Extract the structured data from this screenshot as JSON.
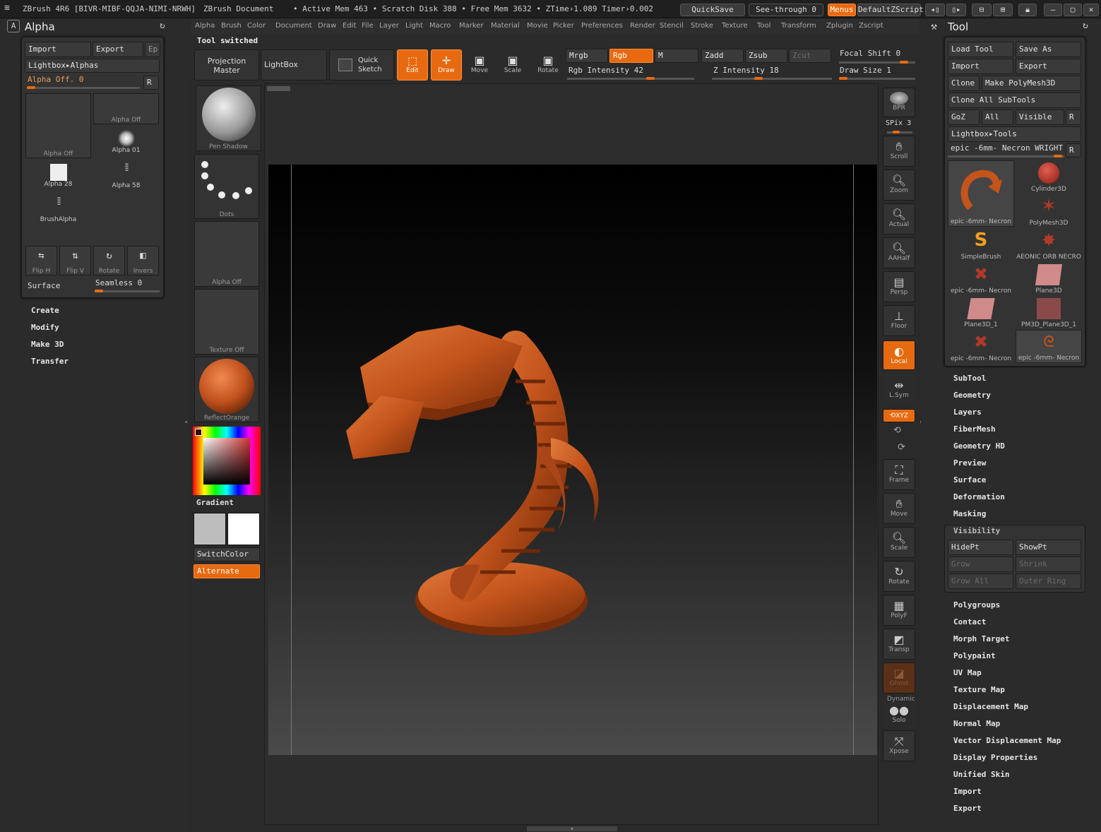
{
  "titlebar": {
    "app": "ZBrush 4R6 [BIVR-MIBF-QQJA-NIMI-NRWH]",
    "doc": "ZBrush Document",
    "mem": "• Active Mem 463 • Scratch Disk 388 • Free Mem 3632 • ZTime›1.089 Timer›0.002",
    "quicksave": "QuickSave",
    "seethrough": "See-through  0",
    "menus": "Menus",
    "script": "DefaultZScript"
  },
  "menus": [
    "Alpha",
    "Brush",
    "Color",
    "Document",
    "Draw",
    "Edit",
    "File",
    "Layer",
    "Light",
    "Macro",
    "Marker",
    "Material",
    "Movie",
    "Picker",
    "Preferences",
    "Render",
    "Stencil",
    "Stroke",
    "Texture",
    "Tool",
    "Transform",
    "Zplugin",
    "Zscript"
  ],
  "status": "Tool switched",
  "alpha": {
    "title": "Alpha",
    "import": "Import",
    "export": "Export",
    "ep": "Ep",
    "lightbox": "Lightbox▸Alphas",
    "slider": "Alpha Off. 0",
    "r": "R",
    "thumbs": [
      "Alpha Off",
      "Alpha Off",
      "Alpha 01",
      "Alpha 28",
      "Alpha 58",
      "BrushAlpha"
    ],
    "tools": [
      "Flip H",
      "Flip V",
      "Rotate",
      "Invers"
    ],
    "surface": "Surface",
    "seamless": "Seamless 0"
  },
  "left_menu": [
    "Create",
    "Modify",
    "Make 3D",
    "Transfer"
  ],
  "shelf": {
    "projection": "Projection Master",
    "lightbox": "LightBox",
    "quicksketch": "Quick Sketch",
    "edit": "Edit",
    "draw": "Draw",
    "move": "Move",
    "scale": "Scale",
    "rotate": "Rotate",
    "mrgb": "Mrgb",
    "rgb": "Rgb",
    "m": "M",
    "zadd": "Zadd",
    "zsub": "Zsub",
    "zcut": "Zcut",
    "rgb_int": "Rgb Intensity 42",
    "z_int": "Z Intensity 18",
    "focal": "Focal Shift 0",
    "drawsize": "Draw Size 1"
  },
  "shelf_slots": {
    "brush": "Pen Shadow",
    "stroke": "Dots",
    "alpha": "Alpha Off",
    "texture": "Texture Off",
    "material": "ReflectOrange",
    "gradient": "Gradient",
    "switch": "SwitchColor",
    "alternate": "Alternate"
  },
  "viewtools": [
    "BPR",
    "SPix 3",
    "Scroll",
    "Zoom",
    "Actual",
    "AAHalf",
    "Persp",
    "Floor",
    "Local",
    "L.Sym",
    "XYZ",
    "Frame",
    "Move",
    "Scale",
    "Rotate",
    "PolyF",
    "Transp",
    "Ghost",
    "Dynamic",
    "Solo",
    "Xpose"
  ],
  "tool": {
    "title": "Tool",
    "load": "Load Tool",
    "saveas": "Save As",
    "import": "Import",
    "export": "Export",
    "clone": "Clone",
    "makepoly": "Make PolyMesh3D",
    "cloneall": "Clone All SubTools",
    "goz": "GoZ",
    "all": "All",
    "visible": "Visible",
    "r": "R",
    "lightbox": "Lightbox▸Tools",
    "current": "epic -6mm- Necron WRIGHT",
    "thumbs": [
      "epic -6mm- Necron",
      "Cylinder3D",
      "",
      "PolyMesh3D",
      "SimpleBrush",
      "AEONIC ORB NECRO",
      "epic -6mm- Necron",
      "Plane3D",
      "Plane3D_1",
      "PM3D_Plane3D_1",
      "epic -6mm- Necron",
      "epic -6mm- Necron"
    ]
  },
  "tool_menu_a": [
    "SubTool",
    "Geometry",
    "Layers",
    "FiberMesh",
    "Geometry HD",
    "Preview",
    "Surface",
    "Deformation",
    "Masking"
  ],
  "visibility": {
    "title": "Visibility",
    "hidept": "HidePt",
    "showpt": "ShowPt",
    "grow": "Grow",
    "shrink": "Shrink",
    "growall": "Grow All",
    "outer": "Outer Ring"
  },
  "tool_menu_b": [
    "Polygroups",
    "Contact",
    "Morph Target",
    "Polypaint",
    "UV Map",
    "Texture Map",
    "Displacement Map",
    "Normal Map",
    "Vector Displacement Map",
    "Display Properties",
    "Unified Skin",
    "Import",
    "Export"
  ],
  "colors": {
    "accent": "#e86a10",
    "model": "#c4541c",
    "bg": "#2b2b2b"
  }
}
